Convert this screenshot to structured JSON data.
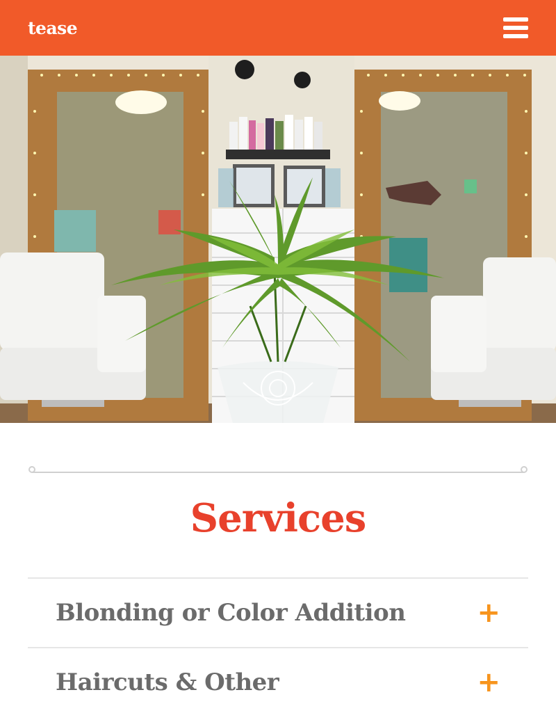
{
  "header": {
    "logo_text": "tease",
    "menu_icon": "hamburger-menu-icon",
    "background": "#f15a29"
  },
  "hero": {
    "description_icon": "salon-interior-photo"
  },
  "services": {
    "title": "Services",
    "title_color": "#e8412c",
    "items": [
      {
        "label": "Blonding or Color Addition",
        "icon": "plus-icon"
      },
      {
        "label": "Haircuts & Other",
        "icon": "plus-icon"
      }
    ]
  },
  "colors": {
    "accent_orange": "#f15a29",
    "plus_orange": "#f7941d",
    "text_gray": "#6b6b6b"
  }
}
